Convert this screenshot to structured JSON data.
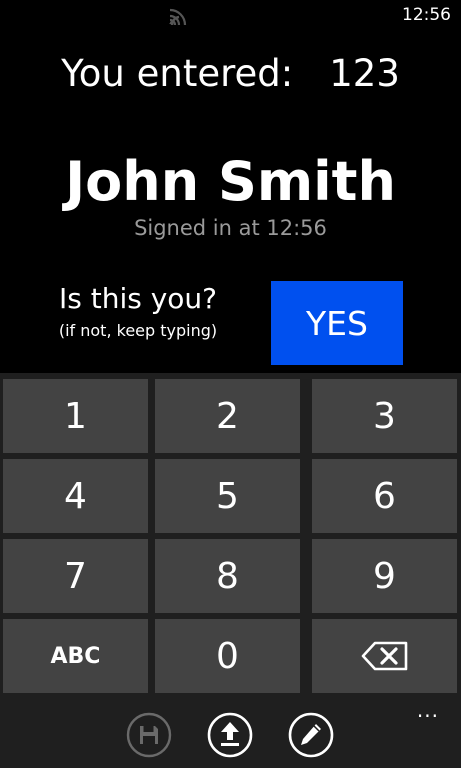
{
  "status_bar": {
    "time": "12:56",
    "signal_icon": "signal-icon"
  },
  "entry": {
    "label": "You entered:",
    "code": "123"
  },
  "user": {
    "name": "John Smith",
    "signed_in": "Signed in at 12:56"
  },
  "confirm": {
    "question": "Is this you?",
    "hint": "(if not, keep typing)",
    "yes_label": "YES",
    "accent_color": "#0050ef"
  },
  "keypad": {
    "keys": [
      "1",
      "2",
      "3",
      "4",
      "5",
      "6",
      "7",
      "8",
      "9",
      "ABC",
      "0"
    ],
    "backspace_icon": "backspace-icon"
  },
  "app_bar": {
    "buttons": [
      {
        "icon": "save-icon",
        "enabled": false
      },
      {
        "icon": "upload-icon",
        "enabled": true
      },
      {
        "icon": "edit-icon",
        "enabled": true
      }
    ],
    "more": "..."
  }
}
